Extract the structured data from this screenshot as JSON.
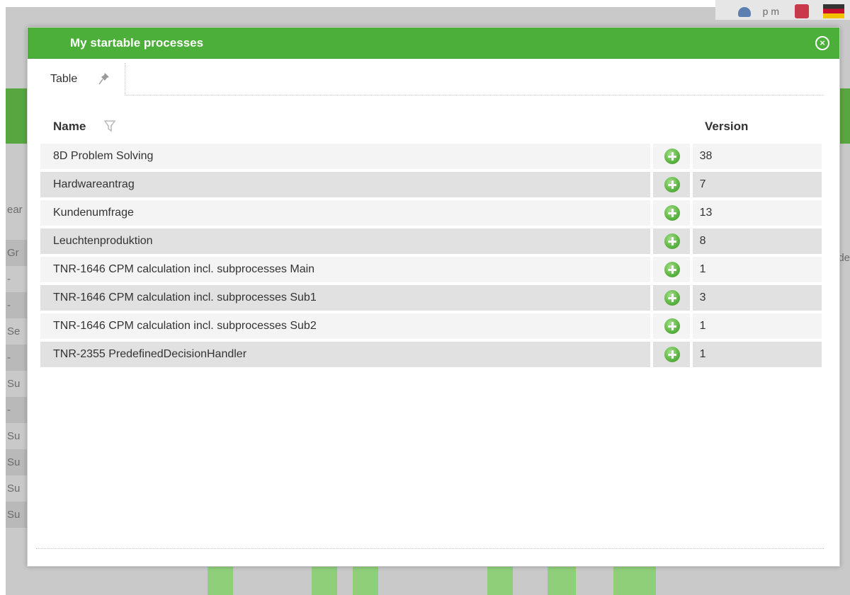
{
  "background": {
    "user_name": "p m",
    "left_column": [
      "ear",
      "Gr",
      "-",
      "-",
      "Se",
      "-",
      "Su",
      "-",
      "Su",
      "Su",
      "Su",
      "Su"
    ],
    "right_label": "de"
  },
  "modal": {
    "title": "My startable processes",
    "close_icon": "close-circle-icon",
    "tabs": [
      {
        "label": "Table",
        "icon": "pin-icon"
      }
    ],
    "table": {
      "columns": {
        "name": "Name",
        "version": "Version"
      },
      "rows": [
        {
          "name": "8D Problem Solving",
          "version": "38"
        },
        {
          "name": "Hardwareantrag",
          "version": "7"
        },
        {
          "name": "Kundenumfrage",
          "version": "13"
        },
        {
          "name": "Leuchtenproduktion",
          "version": "8"
        },
        {
          "name": "TNR-1646 CPM calculation incl. subprocesses Main",
          "version": "1"
        },
        {
          "name": "TNR-1646 CPM calculation incl. subprocesses Sub1",
          "version": "3"
        },
        {
          "name": "TNR-1646 CPM calculation incl. subprocesses Sub2",
          "version": "1"
        },
        {
          "name": "TNR-2355 PredefinedDecisionHandler",
          "version": "1"
        }
      ]
    }
  },
  "colors": {
    "header_green": "#4caf3a",
    "start_button_green": "#5fb845",
    "row_alt": "#e1e1e1",
    "row": "#f4f4f4"
  }
}
